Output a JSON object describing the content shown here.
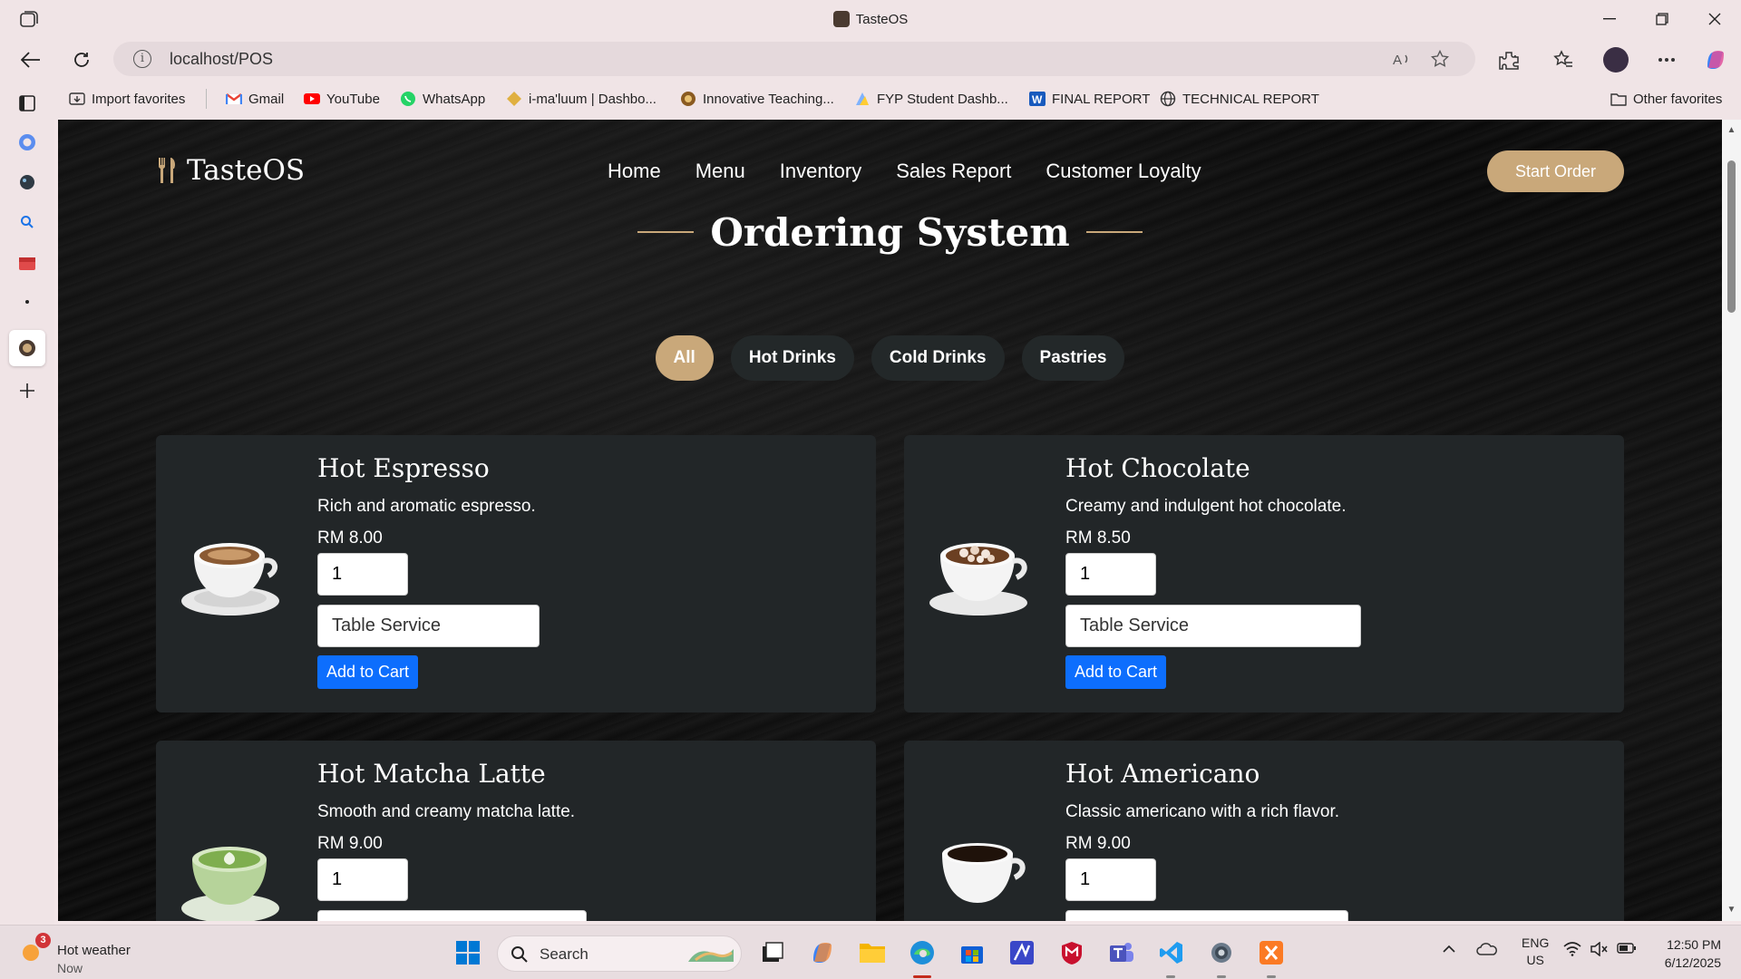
{
  "browser": {
    "tab_title": "TasteOS",
    "url": "localhost/POS",
    "favorites": [
      {
        "label": "Import favorites"
      },
      {
        "label": "Gmail"
      },
      {
        "label": "YouTube"
      },
      {
        "label": "WhatsApp"
      },
      {
        "label": "i-ma'luum | Dashbo..."
      },
      {
        "label": "Innovative Teaching..."
      },
      {
        "label": "FYP Student Dashb..."
      },
      {
        "label": "FINAL REPORT"
      },
      {
        "label": "TECHNICAL REPORT"
      }
    ],
    "other_favorites": "Other favorites"
  },
  "site": {
    "brand": "TasteOS",
    "nav": [
      "Home",
      "Menu",
      "Inventory",
      "Sales Report",
      "Customer Loyalty"
    ],
    "start_order": "Start Order",
    "page_title": "Ordering System",
    "filters": [
      "All",
      "Hot Drinks",
      "Cold Drinks",
      "Pastries"
    ],
    "active_filter": "All",
    "products": [
      {
        "name": "Hot Espresso",
        "description": "Rich and aromatic espresso.",
        "price": "RM 8.00",
        "qty": "1",
        "service": "Table Service",
        "button": "Add to Cart"
      },
      {
        "name": "Hot Chocolate",
        "description": "Creamy and indulgent hot chocolate.",
        "price": "RM 8.50",
        "qty": "1",
        "service": "Table Service",
        "button": "Add to Cart"
      },
      {
        "name": "Hot Matcha Latte",
        "description": "Smooth and creamy matcha latte.",
        "price": "RM 9.00",
        "qty": "1",
        "service": "",
        "button": ""
      },
      {
        "name": "Hot Americano",
        "description": "Classic americano with a rich flavor.",
        "price": "RM 9.00",
        "qty": "1",
        "service": "",
        "button": ""
      }
    ]
  },
  "taskbar": {
    "weather_title": "Hot weather",
    "weather_sub": "Now",
    "weather_badge": "3",
    "search_label": "Search",
    "lang": "ENG",
    "region": "US",
    "time": "12:50 PM",
    "date": "6/12/2025"
  },
  "colors": {
    "accent": "#c9a87a",
    "button_blue": "#0d6efd",
    "card_bg": "#222628"
  }
}
